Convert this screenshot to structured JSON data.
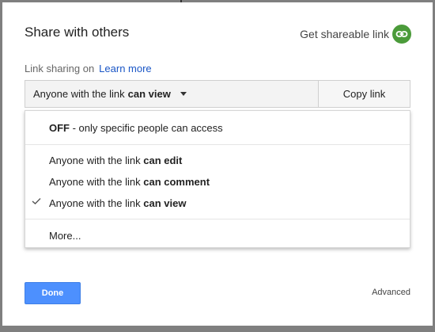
{
  "dialog": {
    "title": "Share with others",
    "get_link_label": "Get shareable link",
    "link_sharing_label": "Link sharing on",
    "learn_more": "Learn more",
    "select": {
      "prefix": "Anyone with the link",
      "bold": "can view"
    },
    "copy_link": "Copy link",
    "menu": {
      "off": {
        "bold": "OFF",
        "rest": " - only specific people can access"
      },
      "items": [
        {
          "prefix": "Anyone with the link ",
          "bold": "can edit"
        },
        {
          "prefix": "Anyone with the link ",
          "bold": "can comment"
        },
        {
          "prefix": "Anyone with the link ",
          "bold": "can view",
          "checked": true
        }
      ],
      "more": "More..."
    },
    "done": "Done",
    "advanced": "Advanced"
  },
  "colors": {
    "link_icon_bg": "#4b9b3a",
    "learn_more": "#1a56c6",
    "done_bg": "#4d90fe"
  },
  "icons": {
    "get_link": "link-icon",
    "selected_check": "check-icon",
    "dropdown": "caret-down-icon"
  }
}
